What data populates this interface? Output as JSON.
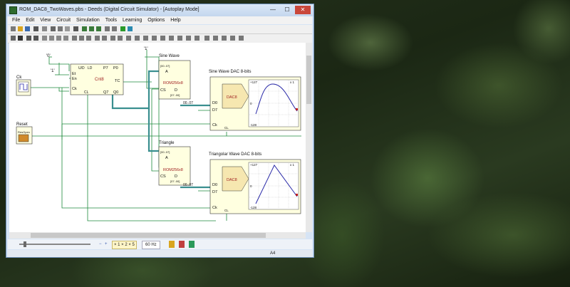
{
  "window": {
    "title": "ROM_DAC8_TwoWaves.pbs - Deeds (Digital Circuit Simulator) - [Autoplay Mode]",
    "controls": {
      "minimize": "—",
      "maximize": "☐",
      "close": "✕"
    }
  },
  "menu": [
    "File",
    "Edit",
    "View",
    "Circuit",
    "Simulation",
    "Tools",
    "Learning",
    "Options",
    "Help"
  ],
  "circuit": {
    "clock_label": "Ck",
    "reset_label": "Reset",
    "reset_button": "ResOpen",
    "counter": {
      "name": "Cnt8",
      "pins": {
        "et": "Et",
        "en": "En",
        "ud": "U/D",
        "ld": "LD",
        "p7": "P7",
        "p0": "P0",
        "tc": "TC",
        "q7": "Q7",
        "q0": "Q0",
        "ck": "Ck",
        "cl": "CL"
      }
    },
    "const_labels": {
      "zero": "'0'",
      "one": "'1'",
      "one_b": "'1'"
    },
    "rom_sine": {
      "title": "Sine Wave",
      "name": "ROM256x8",
      "pins": {
        "a": "A",
        "cs": "CS",
        "d": "D",
        "range": "[07..00]",
        "a_range": "[00..07]"
      }
    },
    "rom_tri": {
      "title": "Triangle",
      "name": "ROM256x8",
      "pins": {
        "a": "A",
        "cs": "CS",
        "d": "D",
        "range": "[07..00]",
        "a_range": "[00..07]"
      }
    },
    "dac_sine": {
      "title": "Sine Wave DAC 8-bits",
      "name": "DAC8",
      "bus": "00..07",
      "pins": {
        "d0": "D0",
        "d7": "D7",
        "ck": "Ck",
        "cl": "CL"
      },
      "ymax": "+127",
      "ymin": "-128",
      "zero": "0",
      "xlabel": "x 1"
    },
    "dac_tri": {
      "title": "Triangolar Wave DAC 8-bits",
      "name": "DAC8",
      "bus": "00..07",
      "pins": {
        "d0": "D0",
        "d7": "D7",
        "ck": "Ck",
        "cl": "CL"
      },
      "ymax": "+127",
      "ymin": "-128",
      "zero": "0",
      "xlabel": "x 1"
    }
  },
  "bottom": {
    "zoom_options": "× 1  × 2  × 5",
    "frequency": "60 Hz"
  },
  "status": {
    "page": "A4"
  },
  "colors": {
    "wire": "#1e8a3c",
    "bus": "#3a8f8f",
    "component_fill": "#ffffe0",
    "trace": "#2a2aa8"
  }
}
